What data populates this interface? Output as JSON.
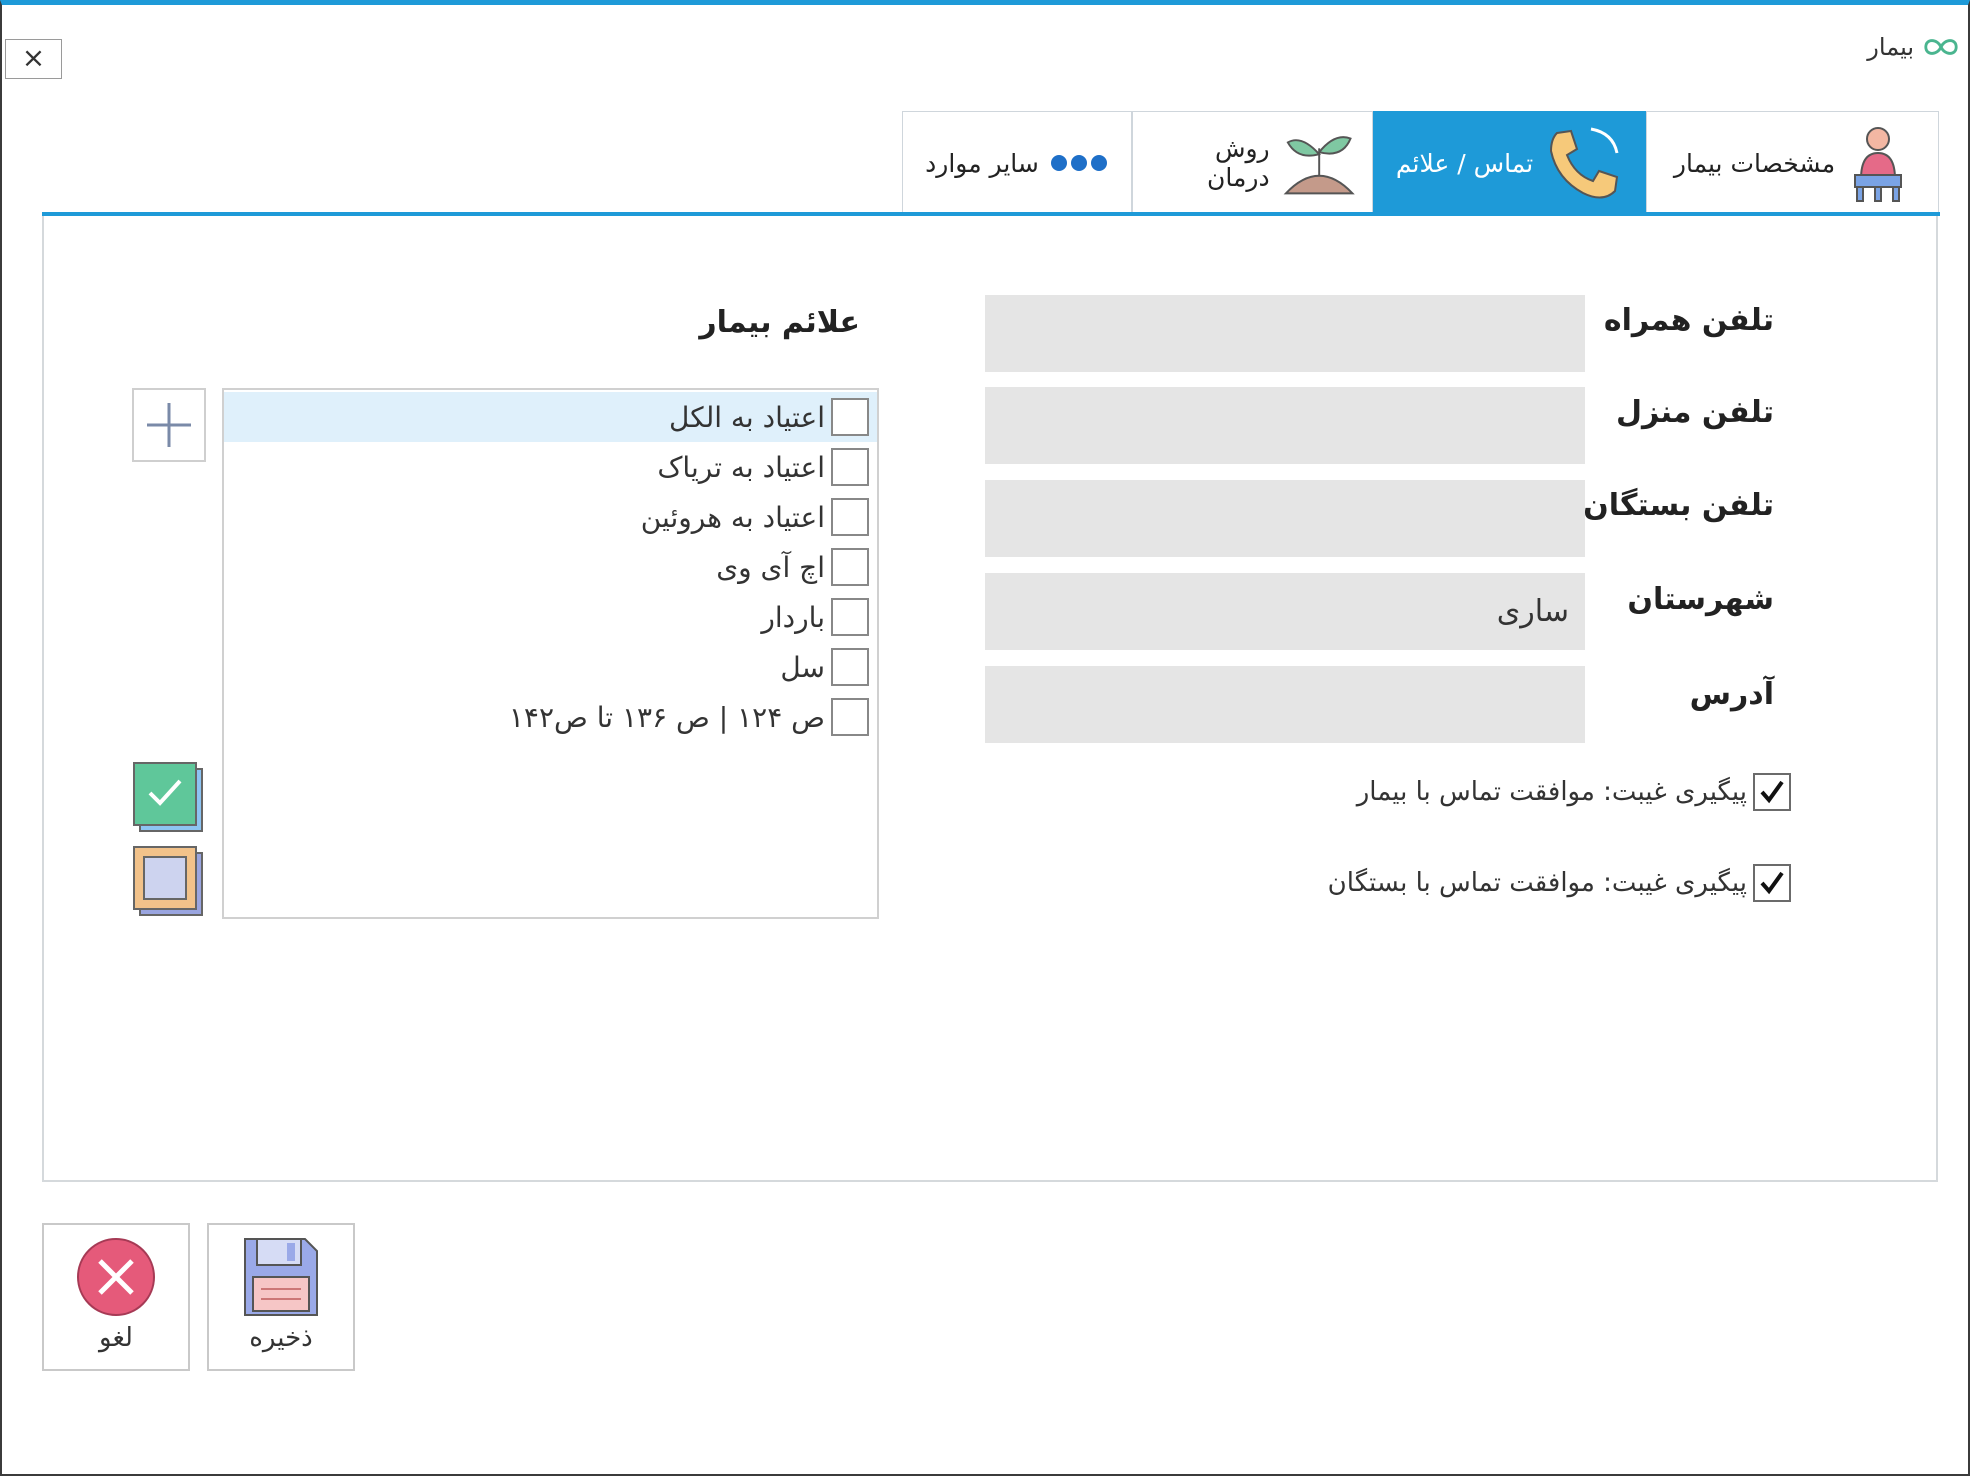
{
  "window": {
    "title": "بیمار",
    "close_label": "×"
  },
  "tabs": [
    {
      "label": "مشخصات بیمار",
      "icon": "patient-chair-icon",
      "active": false
    },
    {
      "label": "تماس / علائم",
      "icon": "phone-icon",
      "active": true
    },
    {
      "label": "روش درمان",
      "icon": "plant-icon",
      "active": false
    },
    {
      "label": "سایر موارد",
      "icon": "dots-icon",
      "active": false
    }
  ],
  "form": {
    "mobile_label": "تلفن همراه",
    "mobile_value": "",
    "home_label": "تلفن منزل",
    "home_value": "",
    "relatives_label": "تلفن بستگان",
    "relatives_value": "",
    "city_label": "شهرستان",
    "city_value": "ساری",
    "address_label": "آدرس",
    "address_value": ""
  },
  "followups": [
    {
      "label": "پیگیری غیبت: موافقت تماس با بیمار",
      "checked": true
    },
    {
      "label": "پیگیری غیبت: موافقت تماس با بستگان",
      "checked": true
    }
  ],
  "symptoms": {
    "title": "علائم بیمار",
    "items": [
      {
        "label": "اعتیاد به الکل",
        "checked": false,
        "selected": true
      },
      {
        "label": "اعتیاد به تریاک",
        "checked": false,
        "selected": false
      },
      {
        "label": "اعتیاد به هروئین",
        "checked": false,
        "selected": false
      },
      {
        "label": "اچ آی وی",
        "checked": false,
        "selected": false
      },
      {
        "label": "باردار",
        "checked": false,
        "selected": false
      },
      {
        "label": "سل",
        "checked": false,
        "selected": false
      },
      {
        "label": "ص ۱۲۴ | ص ۱۳۶ تا ص۱۴۲",
        "checked": false,
        "selected": false
      }
    ]
  },
  "actions": {
    "save_label": "ذخیره",
    "cancel_label": "لغو"
  },
  "colors": {
    "accent": "#1e9ad8",
    "input_bg": "#e5e5e5",
    "selected_row": "#dff0fb",
    "cancel_red": "#e55a7a"
  }
}
